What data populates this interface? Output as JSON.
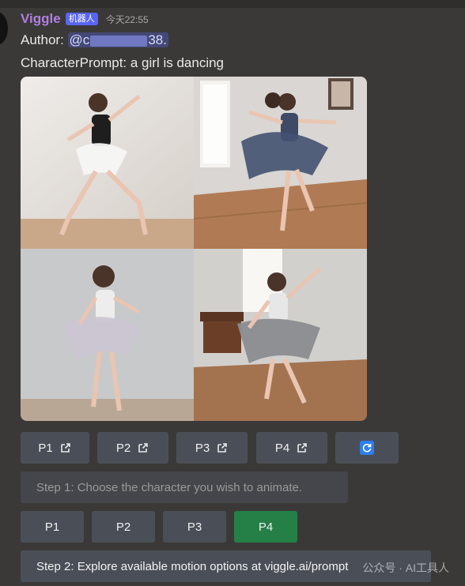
{
  "message": {
    "author": "Viggle",
    "bot_tag": "机器人",
    "timestamp": "今天22:55",
    "author_line_prefix": "Author: ",
    "mention_start": "@c",
    "mention_end": "38.",
    "prompt_line": "CharacterPrompt: a girl is dancing"
  },
  "image_grid": {
    "cells": [
      "P1",
      "P2",
      "P3",
      "P4"
    ]
  },
  "row1_buttons": [
    {
      "label": "P1",
      "icon": "external-link-icon"
    },
    {
      "label": "P2",
      "icon": "external-link-icon"
    },
    {
      "label": "P3",
      "icon": "external-link-icon"
    },
    {
      "label": "P4",
      "icon": "external-link-icon"
    },
    {
      "label": "",
      "icon": "refresh-icon"
    }
  ],
  "step1": "Step 1: Choose the character you wish to animate.",
  "row3_buttons": [
    {
      "label": "P1",
      "selected": false
    },
    {
      "label": "P2",
      "selected": false
    },
    {
      "label": "P3",
      "selected": false
    },
    {
      "label": "P4",
      "selected": true
    }
  ],
  "step2": "Step 2: Explore available motion options at viggle.ai/prompt",
  "watermark": "公众号 · AI工具人",
  "colors": {
    "background": "#3a3937",
    "button": "#4a4f57",
    "button_selected": "#248046",
    "author": "#b07fe0",
    "badge": "#5865f2"
  }
}
